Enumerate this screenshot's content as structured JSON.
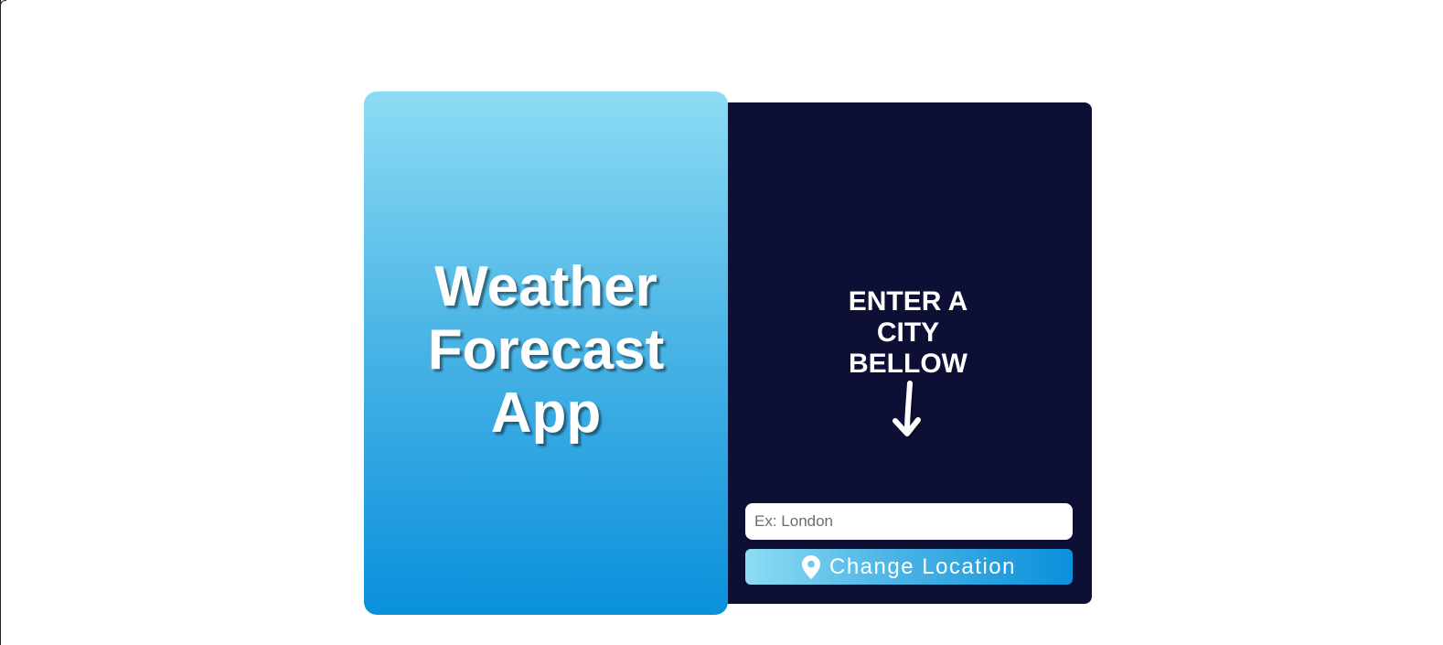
{
  "hero": {
    "title": "Weather Forecast App"
  },
  "panel": {
    "prompt": "ENTER A CITY BELLOW",
    "arrow_icon": "arrow-down-icon",
    "search": {
      "placeholder": "Ex: London",
      "value": ""
    },
    "button": {
      "label": "Change Location",
      "icon": "location-pin-icon"
    }
  },
  "colors": {
    "hero_gradient_top": "#8cdcf3",
    "hero_gradient_bottom": "#0a90dc",
    "panel_background": "#0e0f35",
    "text": "#ffffff"
  }
}
